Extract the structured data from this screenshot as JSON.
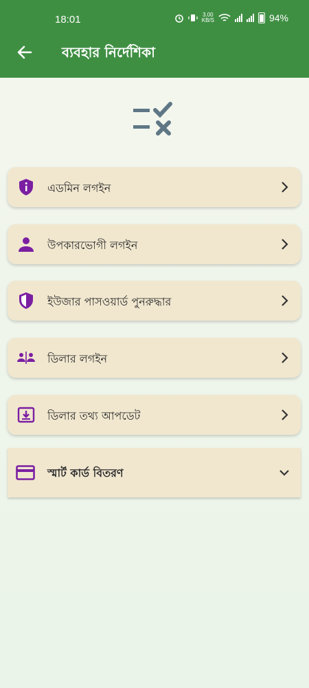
{
  "status_bar": {
    "time": "18:01",
    "net_speed_value": "3.00",
    "net_speed_unit": "KB/S",
    "battery": "94%"
  },
  "app_bar": {
    "title": "ব্যবহার নির্দেশিকা",
    "back_icon": "arrow-left-icon"
  },
  "hero_icon": "checklist-icon",
  "menu": {
    "items": [
      {
        "label": "এডমিন লগইন",
        "icon": "shield-info-icon"
      },
      {
        "label": "উপকারভোগী লগইন",
        "icon": "person-icon"
      },
      {
        "label": "ইউজার পাসওয়ার্ড পুনরুদ্ধার",
        "icon": "shield-half-icon"
      },
      {
        "label": "ডিলার লগইন",
        "icon": "people-divider-icon"
      },
      {
        "label": "ডিলার তথ্য আপডেট",
        "icon": "download-box-icon"
      }
    ],
    "expandable": {
      "label": "স্মার্ট কার্ড বিতরণ",
      "icon": "card-icon",
      "expanded": false
    }
  },
  "colors": {
    "app_bar": "#3f8f43",
    "card": "#f1e7cf",
    "icon_purple": "#7b1fa2",
    "hero_icon": "#5f7785"
  }
}
